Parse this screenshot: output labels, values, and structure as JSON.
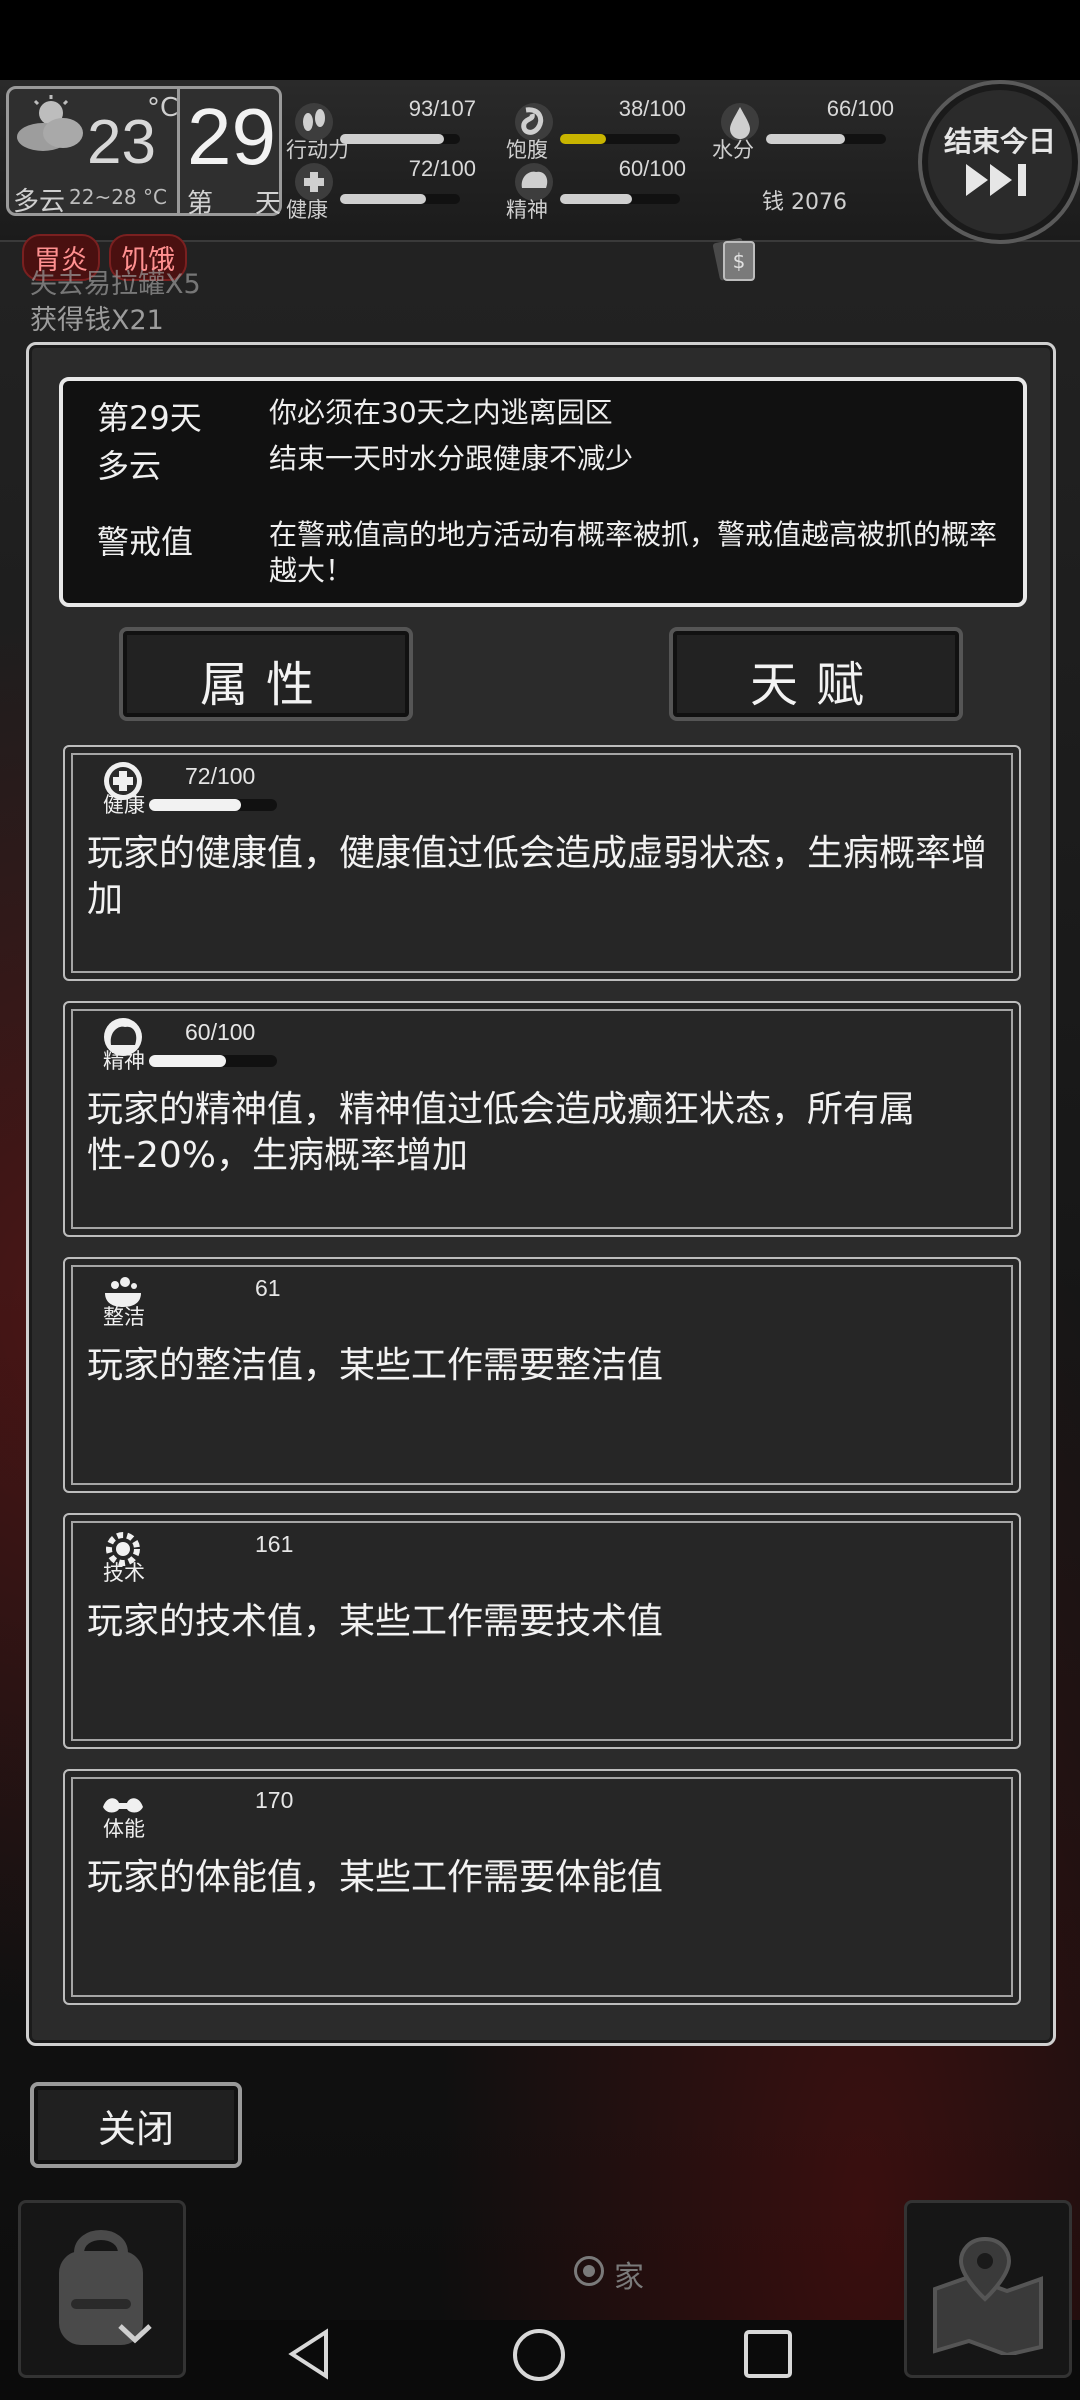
{
  "hud": {
    "temperature": "23",
    "temp_unit": "°C",
    "weather": "多云",
    "temp_range": "22~28 °C",
    "day_number": "29",
    "day_prefix": "第",
    "day_suffix": "天",
    "stats": {
      "action": {
        "label": "行动力",
        "value": "93/107",
        "level": 0.87
      },
      "satiety": {
        "label": "饱腹",
        "value": "38/100",
        "level": 0.38
      },
      "water": {
        "label": "水分",
        "value": "66/100",
        "level": 0.66
      },
      "health": {
        "label": "健康",
        "value": "72/100",
        "level": 0.72
      },
      "spirit": {
        "label": "精神",
        "value": "60/100",
        "level": 0.6
      }
    },
    "money": "钱 2076",
    "end_day_label": "结束今日",
    "end_day_icon": "fast-forward-icon"
  },
  "status_tags": [
    "胃炎",
    "饥饿"
  ],
  "log": {
    "line1": "失去易拉罐X5",
    "line2": "获得钱X21"
  },
  "notice": {
    "day_key": "第29天",
    "day_text": "你必须在30天之内逃离园区",
    "weather_key": "多云",
    "weather_text": "结束一天时水分跟健康不减少",
    "alert_key": "警戒值",
    "alert_text": "在警戒值高的地方活动有概率被抓，警戒值越高被抓的概率越大！"
  },
  "tabs": {
    "attributes": "属性",
    "talents": "天赋"
  },
  "cards": [
    {
      "name": "健康",
      "value": "72/100",
      "level": 0.72,
      "desc": "玩家的健康值，健康值过低会造成虚弱状态，生病概率增加"
    },
    {
      "name": "精神",
      "value": "60/100",
      "level": 0.6,
      "desc": "玩家的精神值，精神值过低会造成癫狂状态，所有属性-20%，生病概率增加"
    },
    {
      "name": "整洁",
      "value": "61",
      "desc": "玩家的整洁值，某些工作需要整洁值"
    },
    {
      "name": "技术",
      "value": "161",
      "desc": "玩家的技术值，某些工作需要技术值"
    },
    {
      "name": "体能",
      "value": "170",
      "desc": "玩家的体能值，某些工作需要体能值"
    }
  ],
  "close_label": "关闭",
  "home_label": "家",
  "colors": {
    "satiety_fill": "#c8b400",
    "tag_text": "#ff9090"
  }
}
